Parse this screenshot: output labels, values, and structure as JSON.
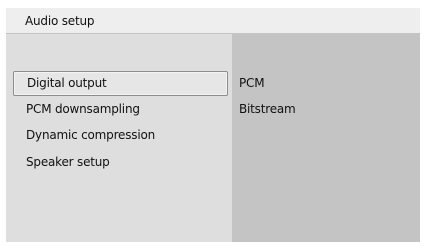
{
  "window": {
    "title": "Audio setup"
  },
  "menu": {
    "items": [
      {
        "label": "Digital output",
        "selected": true
      },
      {
        "label": "PCM downsampling",
        "selected": false
      },
      {
        "label": "Dynamic compression",
        "selected": false
      },
      {
        "label": "Speaker setup",
        "selected": false
      }
    ]
  },
  "options": {
    "items": [
      {
        "label": "PCM"
      },
      {
        "label": "Bitstream"
      }
    ]
  },
  "colors": {
    "title_bar": "#eeeeee",
    "left_pane": "#dedede",
    "right_pane": "#c4c4c4",
    "selection_border": "#8c8c8c"
  }
}
